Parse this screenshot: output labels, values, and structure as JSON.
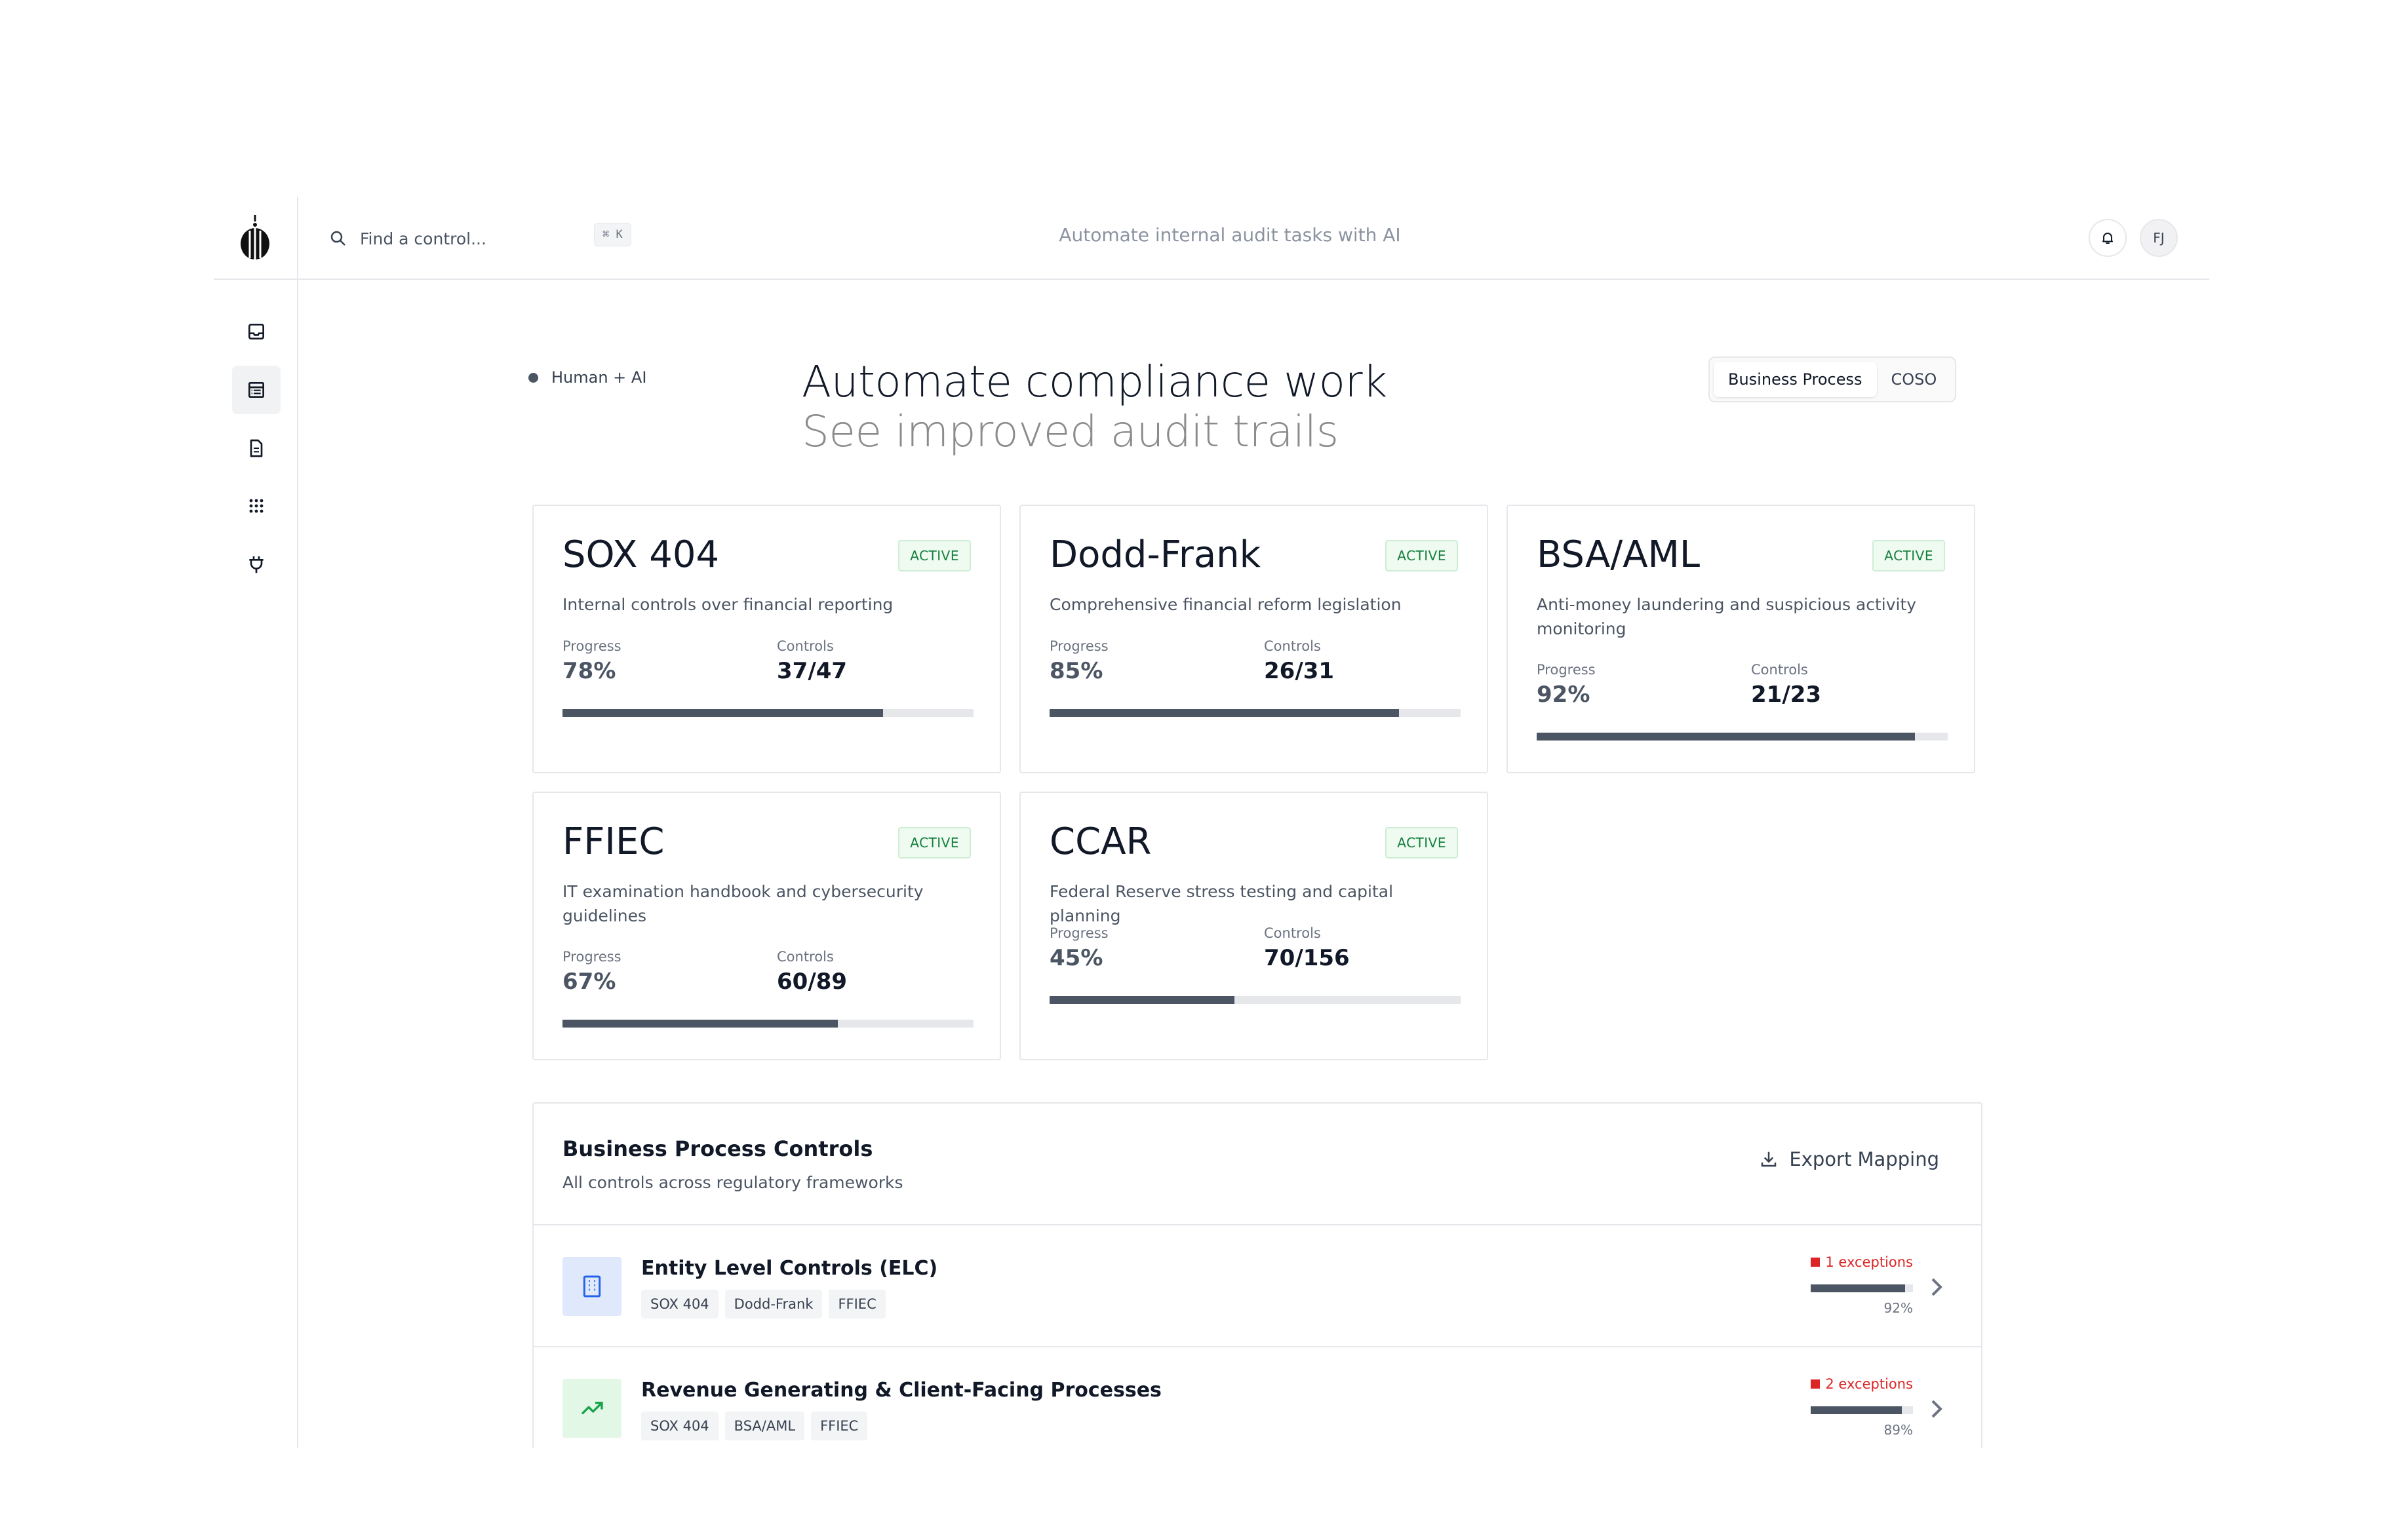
{
  "header": {
    "search_placeholder": "Find a control...",
    "shortcut": "⌘ K",
    "tagline": "Automate internal audit tasks with AI",
    "avatar_initials": "FJ"
  },
  "sidebar": {
    "items": [
      {
        "icon": "inbox-icon",
        "active": false
      },
      {
        "icon": "table-list-icon",
        "active": true
      },
      {
        "icon": "document-icon",
        "active": false
      },
      {
        "icon": "grid-dots-icon",
        "active": false
      },
      {
        "icon": "plug-icon",
        "active": false
      }
    ]
  },
  "hero": {
    "mode_label": "Human + AI",
    "headline": "Automate compliance work",
    "subline": "See improved audit trails",
    "toggle": {
      "options": [
        "Business Process",
        "COSO"
      ],
      "selected": "Business Process"
    }
  },
  "labels": {
    "progress": "Progress",
    "controls": "Controls"
  },
  "frameworks": [
    {
      "name": "SOX 404",
      "status": "ACTIVE",
      "description": "Internal controls over financial reporting",
      "progress_text": "78%",
      "progress": 78,
      "controls": "37/47"
    },
    {
      "name": "Dodd-Frank",
      "status": "ACTIVE",
      "description": "Comprehensive financial reform legislation",
      "progress_text": "85%",
      "progress": 85,
      "controls": "26/31"
    },
    {
      "name": "BSA/AML",
      "status": "ACTIVE",
      "description": "Anti-money laundering and suspicious activity monitoring",
      "progress_text": "92%",
      "progress": 92,
      "controls": "21/23"
    },
    {
      "name": "FFIEC",
      "status": "ACTIVE",
      "description": "IT examination handbook and cybersecurity guidelines",
      "progress_text": "67%",
      "progress": 67,
      "controls": "60/89"
    },
    {
      "name": "CCAR",
      "status": "ACTIVE",
      "description": "Federal Reserve stress testing and capital planning",
      "progress_text": "45%",
      "progress": 45,
      "controls": "70/156"
    }
  ],
  "controls_panel": {
    "title": "Business Process Controls",
    "subtitle": "All controls across regulatory frameworks",
    "export_label": "Export Mapping",
    "rows": [
      {
        "title": "Entity Level Controls (ELC)",
        "icon": "building-icon",
        "tags": [
          "SOX 404",
          "Dodd-Frank",
          "FFIEC"
        ],
        "exceptions": "1 exceptions",
        "percent_text": "92%",
        "percent": 92,
        "icon_bg": "#e0e8fb",
        "icon_color": "#2563eb"
      },
      {
        "title": "Revenue Generating & Client-Facing Processes",
        "icon": "trending-up-icon",
        "tags": [
          "SOX 404",
          "BSA/AML",
          "FFIEC"
        ],
        "exceptions": "2 exceptions",
        "percent_text": "89%",
        "percent": 89,
        "icon_bg": "#e3f7e7",
        "icon_color": "#16a34a"
      }
    ]
  },
  "colors": {
    "accent_dark": "#4b5563",
    "active_badge": "#15803d",
    "exception_red": "#dc2626"
  }
}
